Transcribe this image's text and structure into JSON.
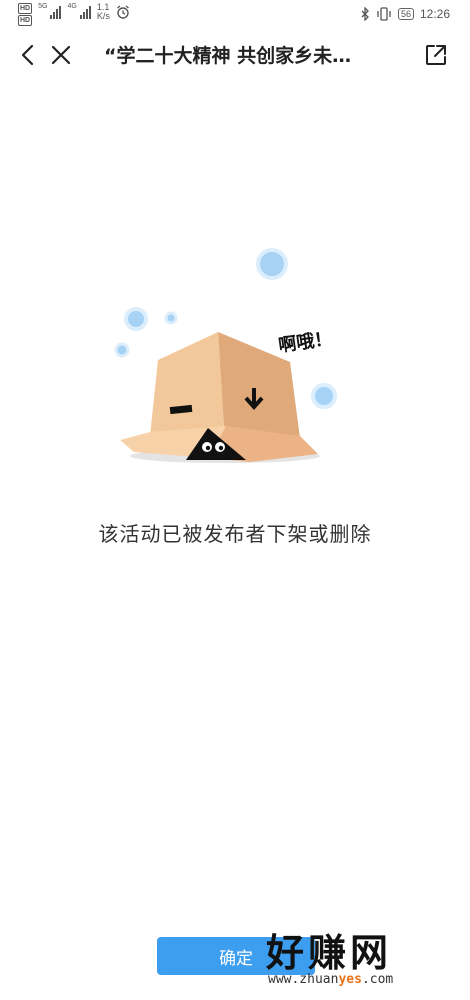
{
  "status_bar": {
    "hd_badges": [
      "HD",
      "HD"
    ],
    "signal1_label": "5G",
    "signal2_label": "4G",
    "net_speed_value": "1.1",
    "net_speed_unit": "K/s",
    "battery": "56",
    "time": "12:26"
  },
  "nav": {
    "title": "“学二十大精神  共创家乡未…"
  },
  "illustration": {
    "exclamation": "啊哦！"
  },
  "message": "该活动已被发布者下架或删除",
  "confirm_label": "确定",
  "watermark": {
    "main": "好赚网",
    "url_prefix": "www.zhuan",
    "url_highlight": "yes",
    "url_suffix": ".com"
  },
  "colors": {
    "accent": "#3d9ef0",
    "bubble": "#a6d2f5",
    "box_light": "#f2c89a",
    "box_dark": "#e0a97a"
  }
}
